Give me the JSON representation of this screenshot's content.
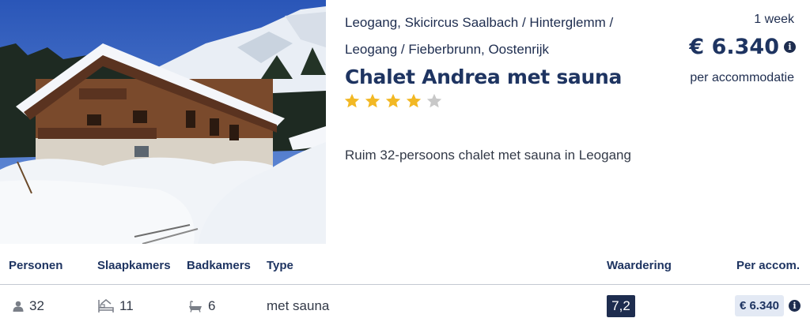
{
  "listing": {
    "location_line1": "Leogang, Skicircus Saalbach / Hinterglemm /",
    "location_line2": "Leogang / Fieberbrunn, Oostenrijk",
    "title": "Chalet Andrea met sauna",
    "rating_stars": 4,
    "max_stars": 5,
    "description": "Ruim 32-persoons chalet met sauna in Leogang",
    "photo": "snowy-chalet-photo"
  },
  "pricing": {
    "duration": "1 week",
    "price": "€ 6.340",
    "unit": "per accommodatie"
  },
  "table": {
    "headers": {
      "persons": "Personen",
      "bedrooms": "Slaapkamers",
      "bathrooms": "Badkamers",
      "type": "Type",
      "rating": "Waardering",
      "price": "Per accom."
    },
    "row": {
      "persons": "32",
      "bedrooms": "11",
      "bathrooms": "6",
      "type": "met sauna",
      "rating": "7,2",
      "price": "€ 6.340"
    }
  },
  "icons": {
    "person": "person-icon",
    "bed": "bed-icon",
    "bath": "bathtub-icon",
    "info": "info-icon",
    "star": "star-icon"
  },
  "colors": {
    "brand_navy": "#1e3461",
    "star_filled": "#f2b824",
    "star_empty": "#c8c8c8",
    "price_badge_bg": "#e3e9f4"
  }
}
